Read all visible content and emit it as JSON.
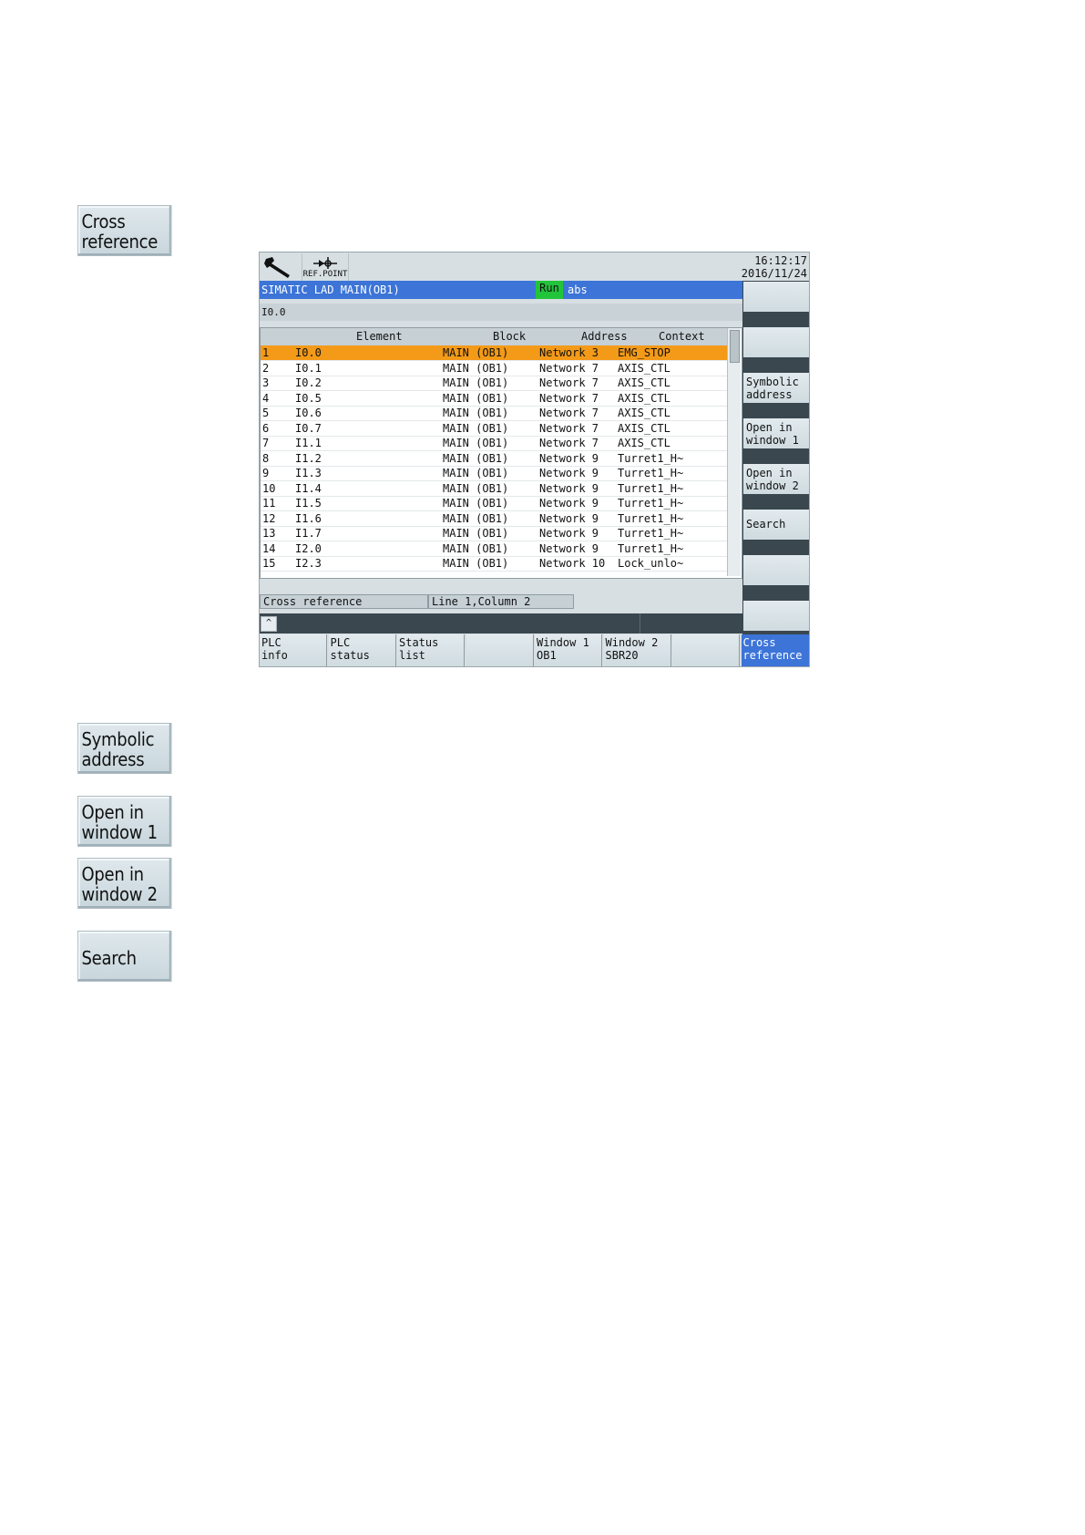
{
  "left_keys": [
    {
      "line1": "Cross",
      "line2": "reference"
    },
    {
      "line1": "Symbolic",
      "line2": "address"
    },
    {
      "line1": "Open in",
      "line2": "window 1"
    },
    {
      "line1": "Open in",
      "line2": "window 2"
    },
    {
      "line1": "Search",
      "line2": ""
    }
  ],
  "screen": {
    "refpoint_label": "REF.POINT",
    "time": "16:12:17",
    "date": "2016/11/24",
    "title": "SIMATIC LAD  MAIN(OB1)",
    "run": "Run",
    "mode": "abs",
    "address_input": "I0.0",
    "table": {
      "headers": {
        "element": "Element",
        "block": "Block",
        "address": "Address",
        "context": "Context"
      },
      "rows": [
        {
          "n": "1",
          "element": "I0.0",
          "block": "MAIN (OB1)",
          "address": "Network 3",
          "context": "EMG_STOP"
        },
        {
          "n": "2",
          "element": "I0.1",
          "block": "MAIN (OB1)",
          "address": "Network 7",
          "context": "AXIS_CTL"
        },
        {
          "n": "3",
          "element": "I0.2",
          "block": "MAIN (OB1)",
          "address": "Network 7",
          "context": "AXIS_CTL"
        },
        {
          "n": "4",
          "element": "I0.5",
          "block": "MAIN (OB1)",
          "address": "Network 7",
          "context": "AXIS_CTL"
        },
        {
          "n": "5",
          "element": "I0.6",
          "block": "MAIN (OB1)",
          "address": "Network 7",
          "context": "AXIS_CTL"
        },
        {
          "n": "6",
          "element": "I0.7",
          "block": "MAIN (OB1)",
          "address": "Network 7",
          "context": "AXIS_CTL"
        },
        {
          "n": "7",
          "element": "I1.1",
          "block": "MAIN (OB1)",
          "address": "Network 7",
          "context": "AXIS_CTL"
        },
        {
          "n": "8",
          "element": "I1.2",
          "block": "MAIN (OB1)",
          "address": "Network 9",
          "context": "Turret1_H~"
        },
        {
          "n": "9",
          "element": "I1.3",
          "block": "MAIN (OB1)",
          "address": "Network 9",
          "context": "Turret1_H~"
        },
        {
          "n": "10",
          "element": "I1.4",
          "block": "MAIN (OB1)",
          "address": "Network 9",
          "context": "Turret1_H~"
        },
        {
          "n": "11",
          "element": "I1.5",
          "block": "MAIN (OB1)",
          "address": "Network 9",
          "context": "Turret1_H~"
        },
        {
          "n": "12",
          "element": "I1.6",
          "block": "MAIN (OB1)",
          "address": "Network 9",
          "context": "Turret1_H~"
        },
        {
          "n": "13",
          "element": "I1.7",
          "block": "MAIN (OB1)",
          "address": "Network 9",
          "context": "Turret1_H~"
        },
        {
          "n": "14",
          "element": "I2.0",
          "block": "MAIN (OB1)",
          "address": "Network 9",
          "context": "Turret1_H~"
        },
        {
          "n": "15",
          "element": "I2.3",
          "block": "MAIN (OB1)",
          "address": "Network 10",
          "context": "Lock_unlo~"
        }
      ]
    },
    "status": {
      "panel": "Cross reference",
      "position": "Line     1,Column 2"
    },
    "up_arrow": "^",
    "hkeys": [
      {
        "line1": "PLC",
        "line2": "info"
      },
      {
        "line1": "PLC",
        "line2": "status"
      },
      {
        "line1": "Status",
        "line2": "list"
      },
      {
        "line1": "",
        "line2": ""
      },
      {
        "line1": "Window 1",
        "line2": "OB1"
      },
      {
        "line1": "Window 2",
        "line2": "SBR20"
      },
      {
        "line1": "",
        "line2": ""
      },
      {
        "line1": "Cross",
        "line2": "reference"
      }
    ],
    "vkeys": [
      {
        "line1": "",
        "line2": ""
      },
      {
        "line1": "",
        "line2": ""
      },
      {
        "line1": "Symbolic",
        "line2": "address"
      },
      {
        "line1": "Open in",
        "line2": "window 1"
      },
      {
        "line1": "Open in",
        "line2": "window 2"
      },
      {
        "line1": "Search",
        "line2": ""
      },
      {
        "line1": "",
        "line2": ""
      },
      {
        "line1": "",
        "line2": ""
      }
    ]
  },
  "colors": {
    "title_blue": "#3c74d8",
    "run_green": "#22c43a",
    "selection_orange": "#f39a18"
  }
}
